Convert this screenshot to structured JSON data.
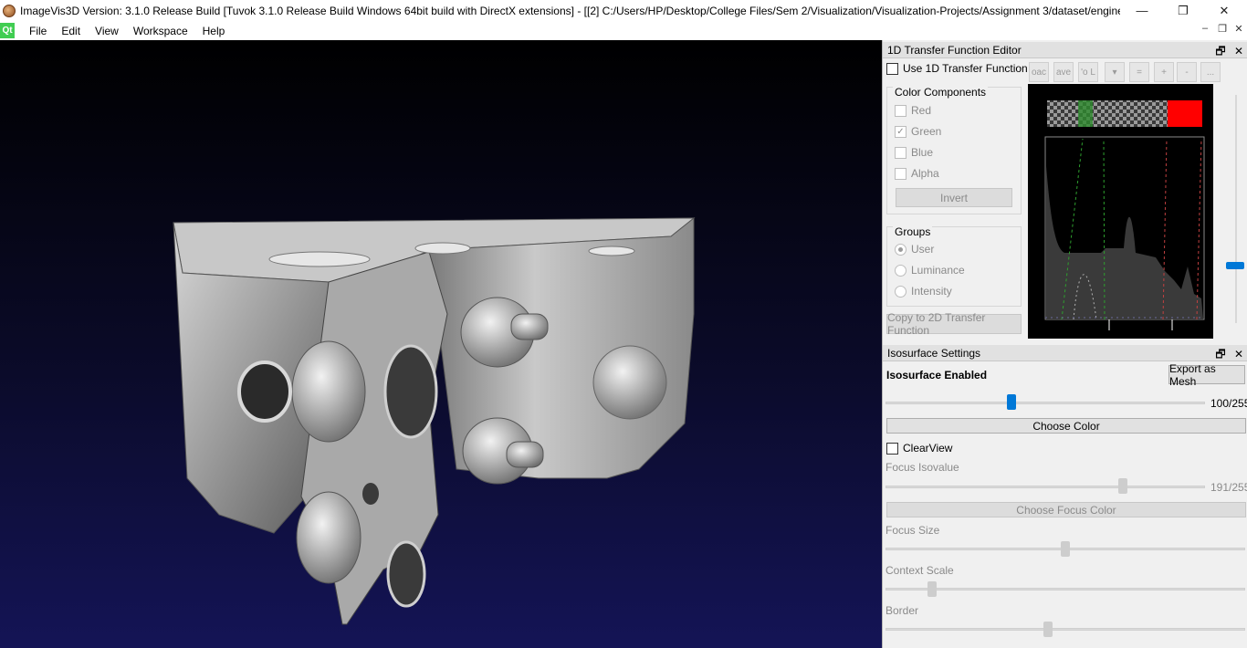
{
  "window": {
    "title": "ImageVis3D Version: 3.1.0 Release Build [Tuvok 3.1.0 Release Build Windows 64bit build with DirectX extensions] - [[2] C:/Users/HP/Desktop/College Files/Sem 2/Visualization/Visualization-Projects/Assignment 3/dataset/engine....",
    "minimize": "—",
    "maximize": "❐",
    "close": "✕"
  },
  "menubar": {
    "logo": "Qt",
    "items": [
      "File",
      "Edit",
      "View",
      "Workspace",
      "Help"
    ],
    "mdi_min": "–",
    "mdi_restore": "❐",
    "mdi_close": "✕"
  },
  "tf_editor": {
    "title": "1D Transfer Function Editor",
    "use_tf_label": "Use 1D Transfer Function",
    "toolbar": [
      "oac",
      "ave",
      "'o L",
      "▾",
      "=",
      "+",
      "-",
      "..."
    ],
    "color_components_title": "Color Components",
    "components": [
      {
        "label": "Red",
        "checked": false
      },
      {
        "label": "Green",
        "checked": true
      },
      {
        "label": "Blue",
        "checked": false
      },
      {
        "label": "Alpha",
        "checked": false
      }
    ],
    "invert_label": "Invert",
    "groups_title": "Groups",
    "groups": [
      {
        "label": "User",
        "selected": true
      },
      {
        "label": "Luminance",
        "selected": false
      },
      {
        "label": "Intensity",
        "selected": false
      }
    ],
    "copy_2d_label": "Copy to 2D Transfer Function",
    "float_btn": "🗗",
    "close_btn": "✕"
  },
  "isosurface": {
    "title": "Isosurface Settings",
    "enabled_label": "Isosurface Enabled",
    "export_label": "Export as Mesh",
    "isovalue_text": "100/255",
    "isovalue": 100,
    "isovalue_max": 255,
    "choose_color_label": "Choose Color",
    "clearview_label": "ClearView",
    "focus_isovalue_label": "Focus Isovalue",
    "focus_isovalue_text": "191/255",
    "focus_isovalue": 191,
    "choose_focus_color_label": "Choose Focus Color",
    "focus_size_label": "Focus Size",
    "focus_size_level": 0.5,
    "context_scale_label": "Context Scale",
    "context_scale_level": 0.12,
    "border_label": "Border",
    "border_level": 0.45,
    "float_btn": "🗗",
    "close_btn": "✕"
  },
  "colors": {
    "viewport_top": "#000000",
    "viewport_bottom": "#141456",
    "slider_active": "#0078d7",
    "slider_inactive": "#cdcdcd",
    "tf_red": "#ff0000",
    "tf_green": "#2e8b2e"
  }
}
